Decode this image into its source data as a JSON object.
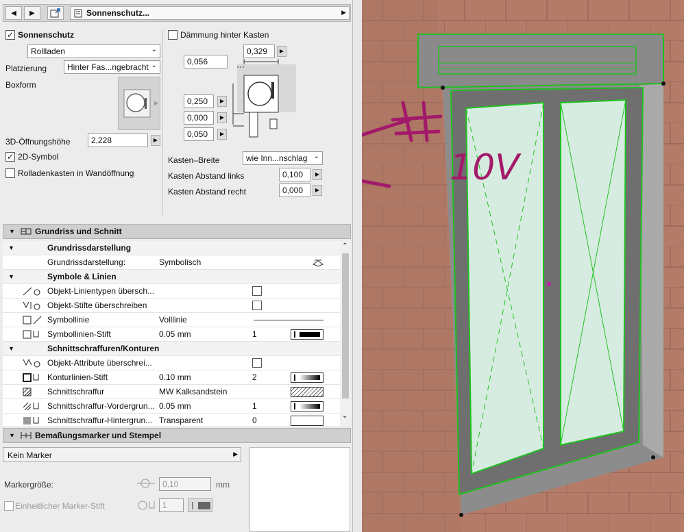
{
  "header": {
    "title": "Sonnenschutz..."
  },
  "sonnenschutz": {
    "enabled_label": "Sonnenschutz",
    "enabled": true,
    "type_value": "Rollladen",
    "platzierung_label": "Platzierung",
    "platzierung_value": "Hinter Fas...ngebracht",
    "boxform_label": "Boxform",
    "oeffnungshoehe_label": "3D-Öffnungshöhe",
    "oeffnungshoehe_value": "2,228",
    "symbol2d_label": "2D-Symbol",
    "symbol2d_checked": true,
    "wandoeffnung_label": "Rolladenkasten in Wandöffnung",
    "wandoeffnung_checked": false,
    "daemmung_label": "Dämmung hinter Kasten",
    "daemmung_checked": false,
    "dim_top": "0,329",
    "dim_left": "0,056",
    "dim_a": "0,250",
    "dim_b": "0,000",
    "dim_c": "0,050",
    "kasten_breite_label": "Kasten–Breite",
    "kasten_breite_value": "wie Inn...nschlag",
    "abstand_links_label": "Kasten Abstand links",
    "abstand_links_value": "0,100",
    "abstand_rechts_label": "Kasten Abstand recht",
    "abstand_rechts_value": "0,000"
  },
  "grundriss_section": {
    "title": "Grundriss und Schnitt"
  },
  "list": {
    "rows": [
      {
        "type": "group",
        "label": "Grundrissdarstellung"
      },
      {
        "type": "item",
        "label": "Grundrissdarstellung:",
        "value": "Symbolisch",
        "icon": "plan-view-icon"
      },
      {
        "type": "group",
        "label": "Symbole & Linien"
      },
      {
        "type": "item",
        "label": "Objekt-Linientypen übersch...",
        "value": "",
        "check": true,
        "icon": "line-type-icon"
      },
      {
        "type": "item",
        "label": "Objekt-Stifte überschreiben",
        "value": "",
        "check": true,
        "icon": "pen-override-icon"
      },
      {
        "type": "item",
        "label": "Symbollinie",
        "value": "Volllinie",
        "line": true,
        "icon": "symbol-line-icon"
      },
      {
        "type": "item",
        "label": "Symbollinien-Stift",
        "value": "0.05 mm",
        "num": "1",
        "swatch": "pen",
        "icon": "symbol-pen-icon"
      },
      {
        "type": "group",
        "label": "Schnittschraffuren/Konturen"
      },
      {
        "type": "item",
        "label": "Objekt-Attribute überschrei...",
        "value": "",
        "check": true,
        "icon": "attribute-override-icon"
      },
      {
        "type": "item",
        "label": "Konturlinien-Stift",
        "value": "0.10 mm",
        "num": "2",
        "swatch": "pen",
        "icon": "contour-pen-icon"
      },
      {
        "type": "item",
        "label": "Schnittschraffur",
        "value": "MW Kalksandstein",
        "swatch": "hatch",
        "icon": "hatch-icon"
      },
      {
        "type": "item",
        "label": "Schnittschraffur-Vordergrun...",
        "value": "0.05 mm",
        "num": "1",
        "swatch": "pen",
        "icon": "hatch-fg-icon"
      },
      {
        "type": "item",
        "label": "Schnittschraffur-Hintergrun...",
        "value": "Transparent",
        "num": "0",
        "swatch": "none",
        "icon": "hatch-bg-icon"
      }
    ]
  },
  "bemassung_section": {
    "title": "Bemaßungsmarker und Stempel"
  },
  "marker": {
    "type_value": "Kein Marker",
    "size_label": "Markergröße:",
    "size_value": "0,10",
    "size_unit": "mm",
    "pen_label": "Einheitlicher Marker-Stift",
    "pen_value": "1"
  },
  "annotation": {
    "text": "10V"
  }
}
